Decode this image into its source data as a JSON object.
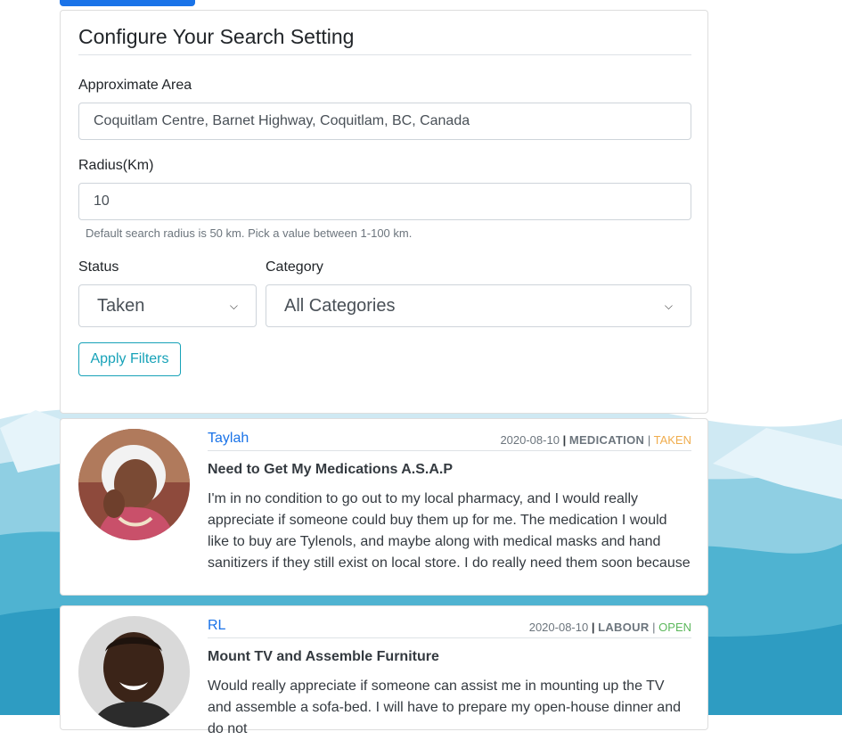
{
  "settings": {
    "title": "Configure Your Search Setting",
    "area_label": "Approximate Area",
    "area_value": "Coquitlam Centre, Barnet Highway, Coquitlam, BC, Canada",
    "radius_label": "Radius(Km)",
    "radius_value": "10",
    "radius_help": "Default search radius is 50 km. Pick a value between 1-100 km.",
    "status_label": "Status",
    "status_value": "Taken",
    "category_label": "Category",
    "category_value": "All Categories",
    "apply_label": "Apply Filters"
  },
  "posts": [
    {
      "author": "Taylah",
      "date": "2020-08-10",
      "category": "MEDICATION",
      "status": "TAKEN",
      "title": "Need to Get My Medications A.S.A.P",
      "body": "I'm in no condition to go out to my local pharmacy, and I would really appreciate if someone could buy them up for me. The medication I would like to buy are Tylenols, and maybe along with medical masks and hand sanitizers if they still exist on local store. I do really need them soon because I need"
    },
    {
      "author": "RL",
      "date": "2020-08-10",
      "category": "LABOUR",
      "status": "OPEN",
      "title": "Mount TV and Assemble Furniture",
      "body": "Would really appreciate if someone can assist me in mounting up the TV and assemble a sofa-bed. I will have to prepare my open-house dinner and do not"
    }
  ],
  "separator": "|",
  "colors": {
    "link": "#1a73e8",
    "taken": "#f0ad4e",
    "open": "#5cb85c",
    "outline_button": "#17a2b8"
  }
}
